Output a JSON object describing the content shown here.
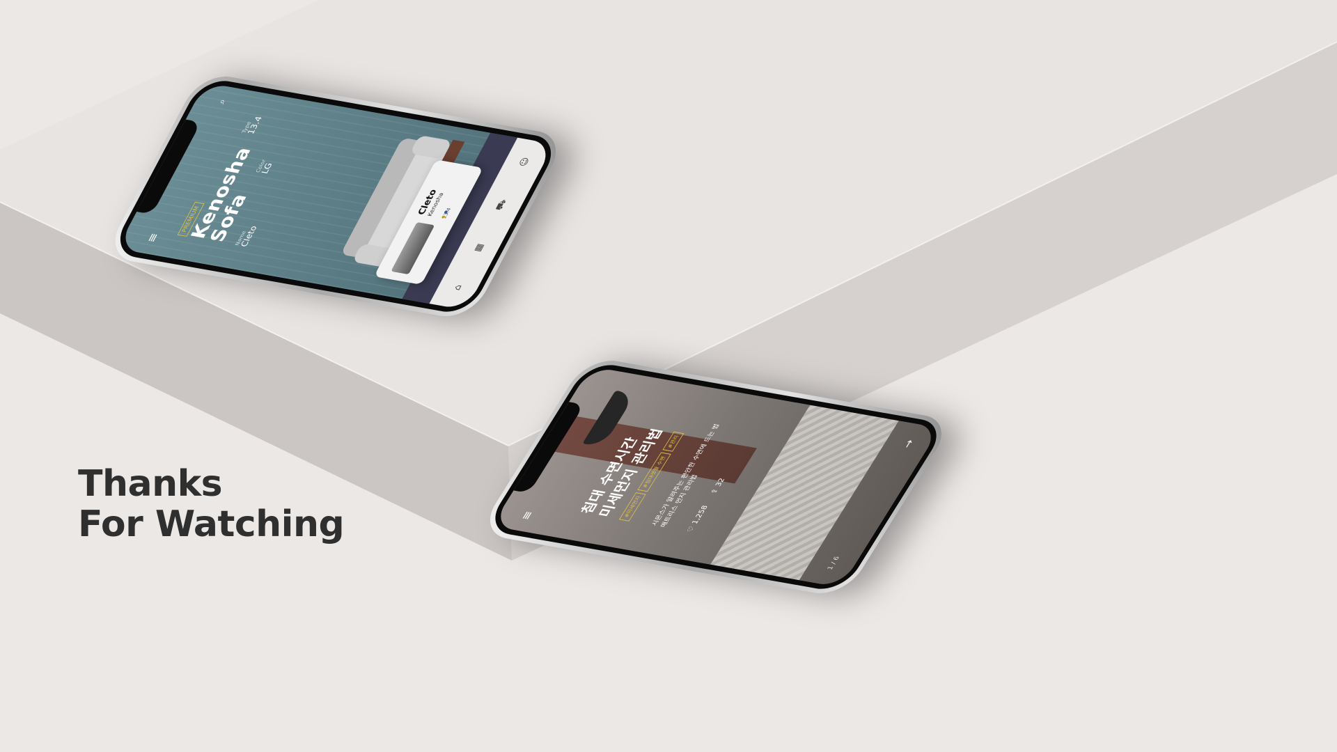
{
  "headline": {
    "line1": "Thanks",
    "line2": "For Watching"
  },
  "phone1": {
    "badge": "PREMIUM",
    "title_line1": "Kenosha",
    "title_line2": "Sofa",
    "meta": [
      {
        "label": "Name",
        "value": "Cleto"
      },
      {
        "label": "Color",
        "value": "LG"
      },
      {
        "label": "Type",
        "value": "13.4"
      }
    ],
    "card": {
      "name": "Cleto",
      "sub": "Kenosha",
      "num": "13.4",
      "dot_colors": [
        "#e2c04a",
        "#2a5db0"
      ]
    },
    "tabs": [
      "⌂",
      "▦",
      "⛟",
      "☺"
    ]
  },
  "phone2": {
    "title_line1": "침대 수면시간",
    "title_line2": "미세먼지 관리법",
    "tags": [
      "#미세먼지",
      "#침대생활 수면",
      "#관리"
    ],
    "desc_line1": "시몬스가 알려주는 편안한 수면에 드는 법",
    "desc_line2": "매트리스 먼지 관리법",
    "likes": "1,258",
    "shares": "32",
    "page": "1 / 6"
  },
  "colors": {
    "accent_gold": "#e2c04a",
    "background": "#ece8e6",
    "headline": "#2f2f2f"
  }
}
